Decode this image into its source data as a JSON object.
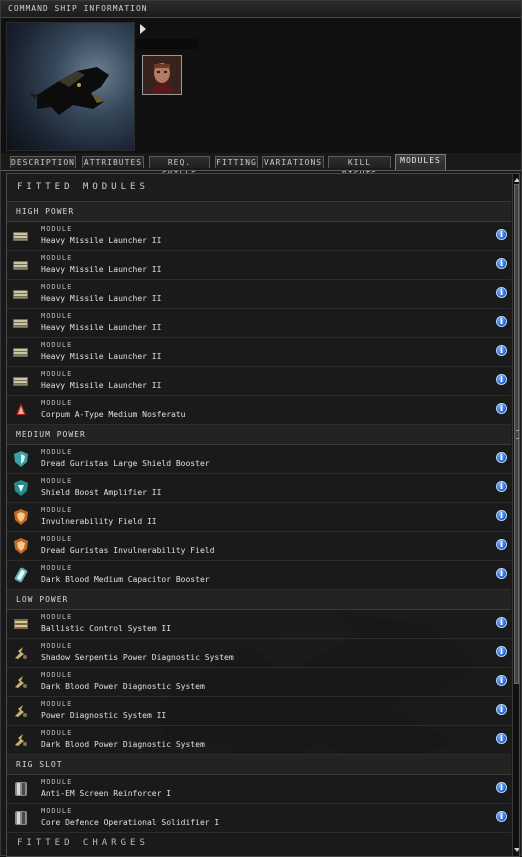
{
  "window": {
    "title": "COMMAND SHIP INFORMATION"
  },
  "tabs": [
    {
      "label": "DESCRIPTION",
      "active": false
    },
    {
      "label": "ATTRIBUTES",
      "active": false
    },
    {
      "label": "REQ. SKILLS",
      "active": false
    },
    {
      "label": "FITTING",
      "active": false
    },
    {
      "label": "VARIATIONS",
      "active": false
    },
    {
      "label": "KILL RIGHTS",
      "active": false
    },
    {
      "label": "MODULES",
      "active": true
    }
  ],
  "modules": {
    "section_title": "FITTED MODULES",
    "groups": [
      {
        "label": "HIGH POWER",
        "items": [
          {
            "kind": "MODULE",
            "name": "Heavy Missile Launcher II",
            "icon": "missile-launcher-icon"
          },
          {
            "kind": "MODULE",
            "name": "Heavy Missile Launcher II",
            "icon": "missile-launcher-icon"
          },
          {
            "kind": "MODULE",
            "name": "Heavy Missile Launcher II",
            "icon": "missile-launcher-icon"
          },
          {
            "kind": "MODULE",
            "name": "Heavy Missile Launcher II",
            "icon": "missile-launcher-icon"
          },
          {
            "kind": "MODULE",
            "name": "Heavy Missile Launcher II",
            "icon": "missile-launcher-icon"
          },
          {
            "kind": "MODULE",
            "name": "Heavy Missile Launcher II",
            "icon": "missile-launcher-icon"
          },
          {
            "kind": "MODULE",
            "name": "Corpum A-Type Medium Nosferatu",
            "icon": "nosferatu-icon"
          }
        ]
      },
      {
        "label": "MEDIUM POWER",
        "items": [
          {
            "kind": "MODULE",
            "name": "Dread Guristas Large Shield Booster",
            "icon": "shield-booster-icon"
          },
          {
            "kind": "MODULE",
            "name": "Shield Boost Amplifier II",
            "icon": "shield-amplifier-icon"
          },
          {
            "kind": "MODULE",
            "name": "Invulnerability Field II",
            "icon": "invulnerability-field-icon"
          },
          {
            "kind": "MODULE",
            "name": "Dread Guristas Invulnerability Field",
            "icon": "invulnerability-field-icon"
          },
          {
            "kind": "MODULE",
            "name": "Dark Blood Medium Capacitor Booster",
            "icon": "capacitor-booster-icon"
          }
        ]
      },
      {
        "label": "LOW POWER",
        "items": [
          {
            "kind": "MODULE",
            "name": "Ballistic Control System II",
            "icon": "ballistic-control-icon"
          },
          {
            "kind": "MODULE",
            "name": "Shadow Serpentis Power Diagnostic System",
            "icon": "power-diagnostic-icon"
          },
          {
            "kind": "MODULE",
            "name": "Dark Blood Power Diagnostic System",
            "icon": "power-diagnostic-icon"
          },
          {
            "kind": "MODULE",
            "name": "Power Diagnostic System II",
            "icon": "power-diagnostic-icon"
          },
          {
            "kind": "MODULE",
            "name": "Dark Blood Power Diagnostic System",
            "icon": "power-diagnostic-icon"
          }
        ]
      },
      {
        "label": "RIG SLOT",
        "items": [
          {
            "kind": "MODULE",
            "name": "Anti-EM Screen Reinforcer I",
            "icon": "rig-icon"
          },
          {
            "kind": "MODULE",
            "name": "Core Defence Operational Solidifier I",
            "icon": "rig-icon"
          }
        ]
      }
    ],
    "next_section_title": "FITTED CHARGES"
  },
  "info_icon_glyph": "i",
  "colors": {
    "info_blue": "#1e5ec8",
    "panel_bg": "#1a1a1a"
  }
}
